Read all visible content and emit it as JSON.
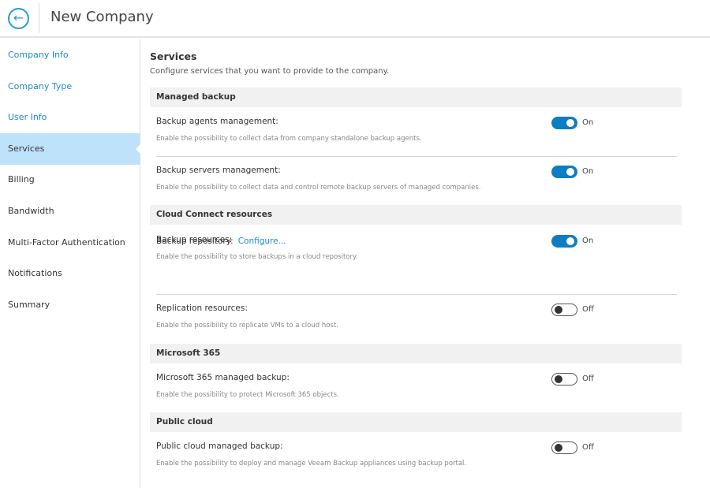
{
  "header": {
    "title": "New Company",
    "back_icon": "arrow-left-circle-icon"
  },
  "sidebar": {
    "items": [
      {
        "label": "Company Info",
        "state": "link"
      },
      {
        "label": "Company Type",
        "state": "link"
      },
      {
        "label": "User Info",
        "state": "link"
      },
      {
        "label": "Services",
        "state": "active"
      },
      {
        "label": "Billing",
        "state": ""
      },
      {
        "label": "Bandwidth",
        "state": ""
      },
      {
        "label": "Multi-Factor Authentication",
        "state": ""
      },
      {
        "label": "Notifications",
        "state": ""
      },
      {
        "label": "Summary",
        "state": ""
      }
    ]
  },
  "main": {
    "title": "Services",
    "subtitle": "Configure services that you want to provide to the company.",
    "sections": [
      {
        "title": "Managed backup"
      },
      {
        "title": "Cloud Connect resources"
      },
      {
        "title": "Microsoft 365"
      },
      {
        "title": "Public cloud"
      }
    ],
    "rows": [
      {
        "label": "Backup agents management:",
        "desc": "Enable the possibility to collect data from company standalone backup agents.",
        "toggle": "On"
      },
      {
        "label": "Backup servers management:",
        "desc": "Enable the possibility to collect data and control remote backup servers of managed companies.",
        "toggle": "On"
      },
      {
        "label": "Backup resources:",
        "desc": "Enable the possibility to store backups in a cloud repository.",
        "toggle": "On"
      },
      {
        "label": "Replication resources:",
        "desc": "Enable the possibility to replicate VMs to a cloud host.",
        "toggle": "Off"
      },
      {
        "label": "Microsoft 365 managed backup:",
        "desc": "Enable the possibility to protect Microsoft 365 objects.",
        "toggle": "Off"
      },
      {
        "label": "Public cloud managed backup:",
        "desc": "Enable the possibility to deploy and manage Veeam Backup appliances using backup portal.",
        "toggle": "Off"
      }
    ],
    "repository": {
      "label": "Backup repository:",
      "link": "Configure..."
    }
  },
  "colors": {
    "accent": "#0f7dc2",
    "active_nav": "#bfe2fb"
  }
}
